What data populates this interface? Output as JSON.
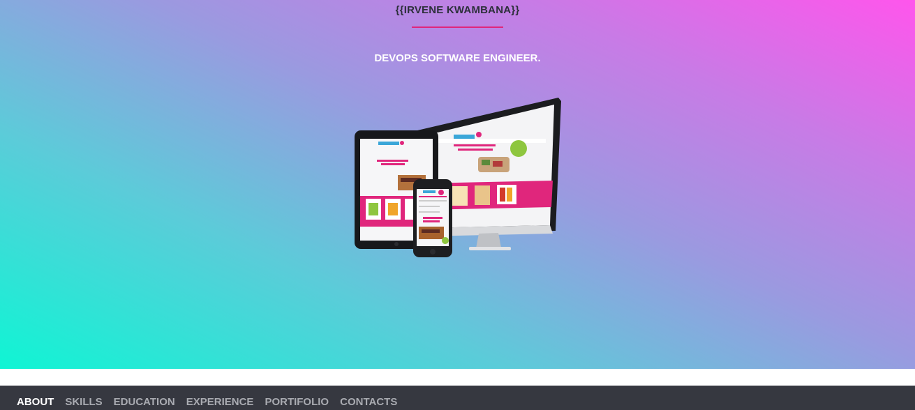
{
  "hero": {
    "title": "{{IRVENE KWAMBANA}}",
    "subtitle": "DEVOPS SOFTWARE ENGINEER.",
    "image_icon": "responsive-devices-illustration"
  },
  "colors": {
    "accent": "#e0267c",
    "gradient_start": "#0ff5d4",
    "gradient_end": "#ff55ec",
    "nav_bg": "#363840"
  },
  "nav": {
    "items": [
      {
        "label": "ABOUT",
        "active": true
      },
      {
        "label": "SKILLS",
        "active": false
      },
      {
        "label": "EDUCATION",
        "active": false
      },
      {
        "label": "EXPERIENCE",
        "active": false
      },
      {
        "label": "PORTIFOLIO",
        "active": false
      },
      {
        "label": "CONTACTS",
        "active": false
      }
    ]
  }
}
